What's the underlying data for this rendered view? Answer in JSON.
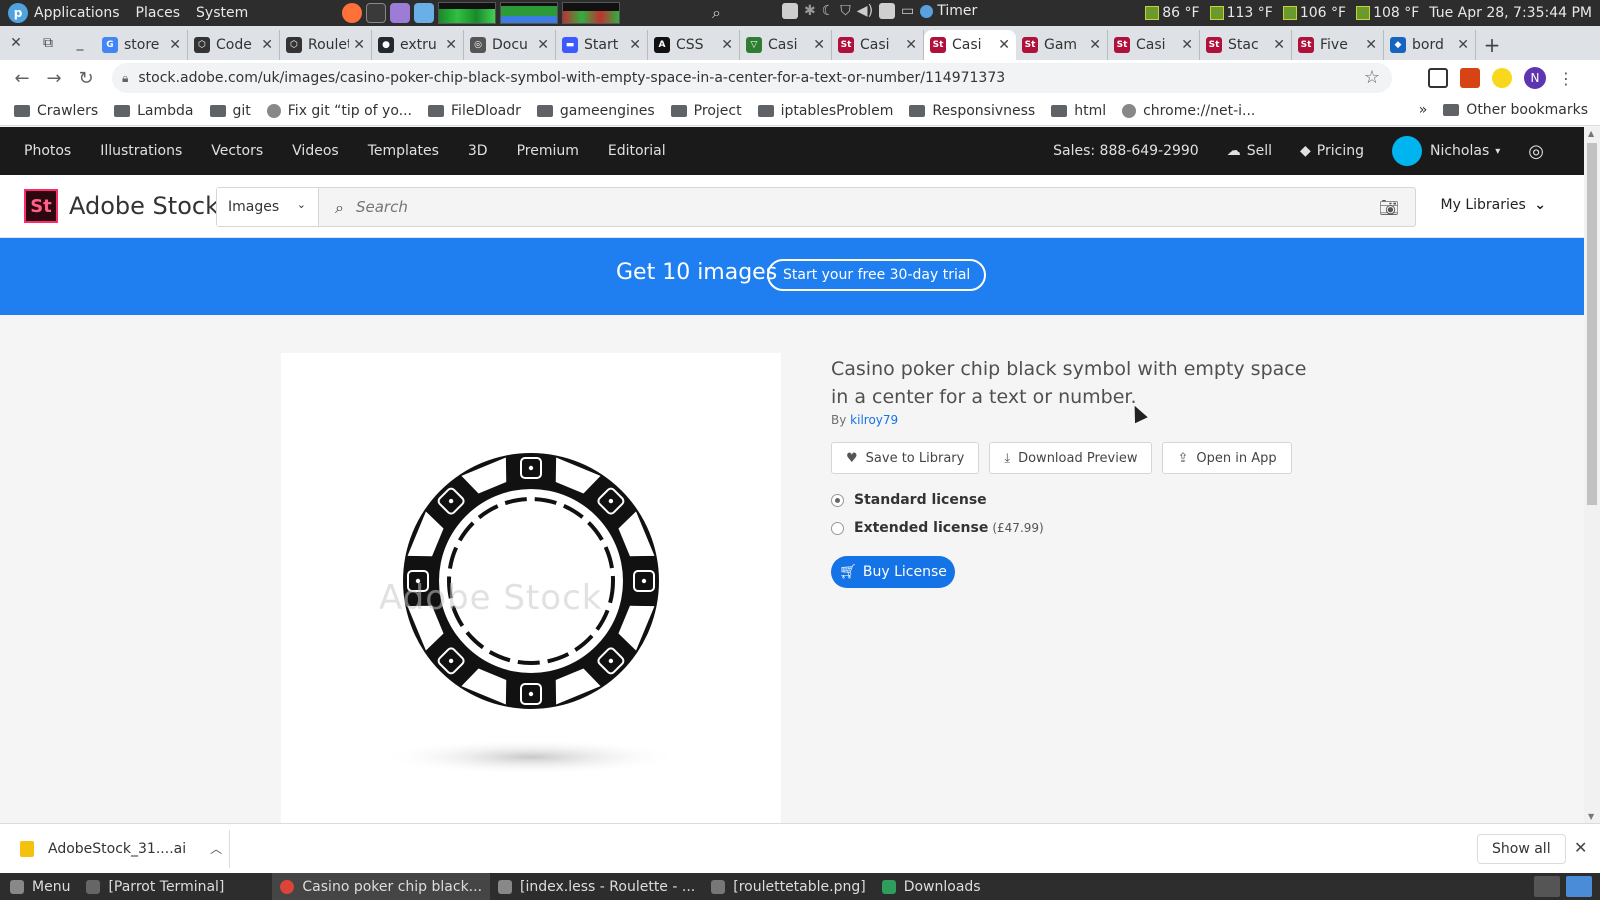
{
  "os": {
    "menu": [
      "Applications",
      "Places",
      "System"
    ],
    "timer_label": "Timer",
    "temps": [
      "86 °F",
      "113 °F",
      "106 °F",
      "108 °F"
    ],
    "clock": "Tue Apr 28, 7:35:44 PM"
  },
  "tabs": [
    {
      "label": "store",
      "color": "#4285f4",
      "glyph": "G"
    },
    {
      "label": "Code",
      "color": "#333333",
      "glyph": "⬡"
    },
    {
      "label": "Roulette",
      "color": "#333333",
      "glyph": "⬡"
    },
    {
      "label": "extru",
      "color": "#24292e",
      "glyph": "●"
    },
    {
      "label": "Docu",
      "color": "#555555",
      "glyph": "◎"
    },
    {
      "label": "Start",
      "color": "#3d5afe",
      "glyph": "▬"
    },
    {
      "label": "CSS",
      "color": "#111111",
      "glyph": "A"
    },
    {
      "label": "Casi",
      "color": "#2e7d32",
      "glyph": "▽"
    },
    {
      "label": "Casi",
      "color": "#b0103a",
      "glyph": "St"
    },
    {
      "label": "Casi",
      "color": "#b0103a",
      "glyph": "St",
      "active": true
    },
    {
      "label": "Gam",
      "color": "#b0103a",
      "glyph": "St"
    },
    {
      "label": "Casi",
      "color": "#b0103a",
      "glyph": "St"
    },
    {
      "label": "Stac",
      "color": "#b0103a",
      "glyph": "St"
    },
    {
      "label": "Five",
      "color": "#b0103a",
      "glyph": "St"
    },
    {
      "label": "bord",
      "color": "#1565c0",
      "glyph": "◆"
    }
  ],
  "address": {
    "url": "stock.adobe.com/uk/images/casino-poker-chip-black-symbol-with-empty-space-in-a-center-for-a-text-or-number/114971373",
    "avatar_letter": "N"
  },
  "bookmarks": [
    {
      "label": "Crawlers",
      "type": "folder"
    },
    {
      "label": "Lambda",
      "type": "folder"
    },
    {
      "label": "git",
      "type": "folder"
    },
    {
      "label": "Fix git “tip of yo...",
      "type": "page"
    },
    {
      "label": "FileDloadr",
      "type": "folder"
    },
    {
      "label": "gameengines",
      "type": "folder"
    },
    {
      "label": "Project",
      "type": "folder"
    },
    {
      "label": "iptablesProblem",
      "type": "folder"
    },
    {
      "label": "Responsivness",
      "type": "folder"
    },
    {
      "label": "html",
      "type": "folder"
    },
    {
      "label": "chrome://net-i...",
      "type": "page"
    }
  ],
  "bookmarks_more": "»",
  "bookmarks_other": "Other bookmarks",
  "site": {
    "nav": [
      "Photos",
      "Illustrations",
      "Vectors",
      "Videos",
      "Templates",
      "3D",
      "Premium",
      "Editorial"
    ],
    "sales": "Sales: 888-649-2990",
    "sell": "Sell",
    "pricing": "Pricing",
    "user": "Nicholas",
    "logo_mark": "St",
    "logo_text": "Adobe Stock",
    "search_type": "Images",
    "search_placeholder": "Search",
    "my_libraries": "My Libraries",
    "promo_text": "Get 10 images",
    "promo_button": "Start your free 30-day trial"
  },
  "asset": {
    "watermark": "Adobe Stock",
    "title": "Casino poker chip black symbol with empty space in a center for a text or number.",
    "by": "By",
    "author": "kilroy79",
    "actions": [
      "Save to Library",
      "Download Preview",
      "Open in App"
    ],
    "licenses": [
      {
        "label": "Standard license",
        "price": "",
        "selected": true
      },
      {
        "label": "Extended license",
        "price": "(£47.99)",
        "selected": false
      }
    ],
    "buy": "Buy License"
  },
  "downloads": {
    "file": "AdobeStock_31....ai",
    "show_all": "Show all"
  },
  "taskbar": [
    {
      "label": "Menu",
      "color": "#888888"
    },
    {
      "label": "[Parrot Terminal]",
      "color": "#666666"
    },
    {
      "label": "Casino poker chip black...",
      "color": "#db4437",
      "active": true
    },
    {
      "label": "[index.less - Roulette - ...",
      "color": "#888888"
    },
    {
      "label": "[roulettetable.png]",
      "color": "#777777"
    },
    {
      "label": "Downloads",
      "color": "#2e9d5e"
    }
  ]
}
